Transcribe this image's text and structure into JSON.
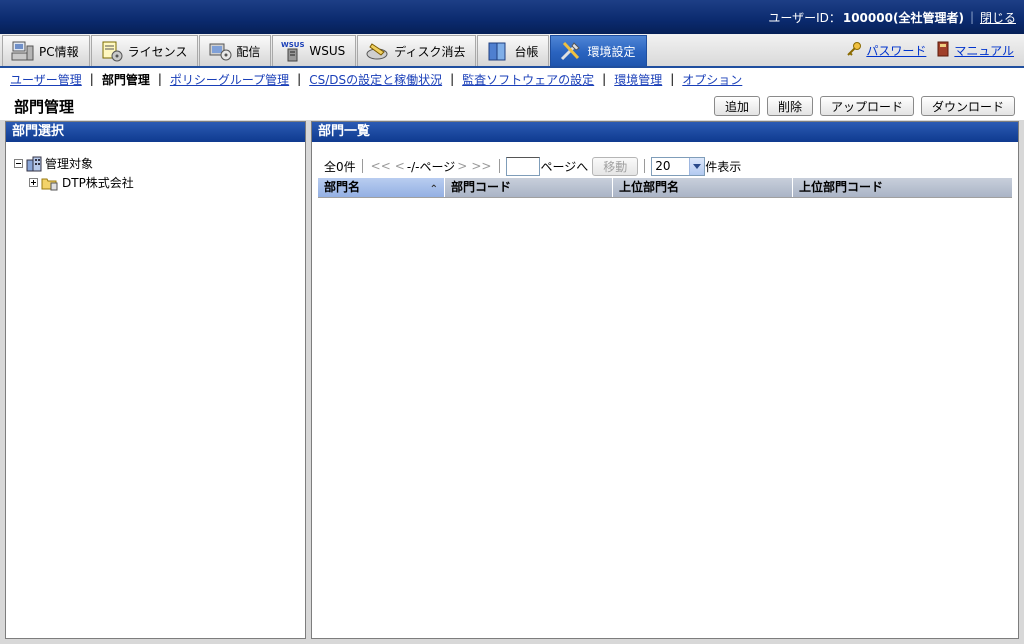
{
  "header": {
    "user_label": "ユーザーID：",
    "user_value": "100000(全社管理者)",
    "close_link": "閉じる"
  },
  "tabs": [
    {
      "label": "PC情報",
      "icon": "pc-icon"
    },
    {
      "label": "ライセンス",
      "icon": "license-icon"
    },
    {
      "label": "配信",
      "icon": "distribution-icon"
    },
    {
      "label": "WSUS",
      "icon": "wsus-icon"
    },
    {
      "label": "ディスク消去",
      "icon": "disk-erase-icon"
    },
    {
      "label": "台帳",
      "icon": "ledger-icon"
    },
    {
      "label": "環境設定",
      "icon": "settings-tools-icon",
      "active": true
    }
  ],
  "tab_right": {
    "password": "パスワード",
    "manual": "マニュアル"
  },
  "subnav": {
    "items": [
      "ユーザー管理",
      "部門管理",
      "ポリシーグループ管理",
      "CS/DSの設定と稼働状況",
      "監査ソフトウェアの設定",
      "環境管理",
      "オプション"
    ],
    "current_index": 1
  },
  "page": {
    "title": "部門管理",
    "buttons": {
      "add": "追加",
      "delete": "削除",
      "upload": "アップロード",
      "download": "ダウンロード"
    }
  },
  "left_panel": {
    "title": "部門選択",
    "tree_root": "管理対象",
    "tree_child": "DTP株式会社"
  },
  "right_panel": {
    "title": "部門一覧",
    "pager": {
      "total": "全0件",
      "first": "<<",
      "prev": "<",
      "page_text": "-/-ページ",
      "next": ">",
      "last": ">>",
      "page_input_value": "",
      "goto_suffix": "ページへ",
      "move_button": "移動",
      "per_page": "20",
      "per_page_suffix": "件表示"
    },
    "columns": [
      "部門名",
      "部門コード",
      "上位部門名",
      "上位部門コード"
    ],
    "rows": []
  },
  "colors": {
    "header_bg": "#0b2a6e",
    "active_tab": "#2a63bf",
    "panel_header": "#1a4aa0",
    "link": "#1a3fb8"
  }
}
